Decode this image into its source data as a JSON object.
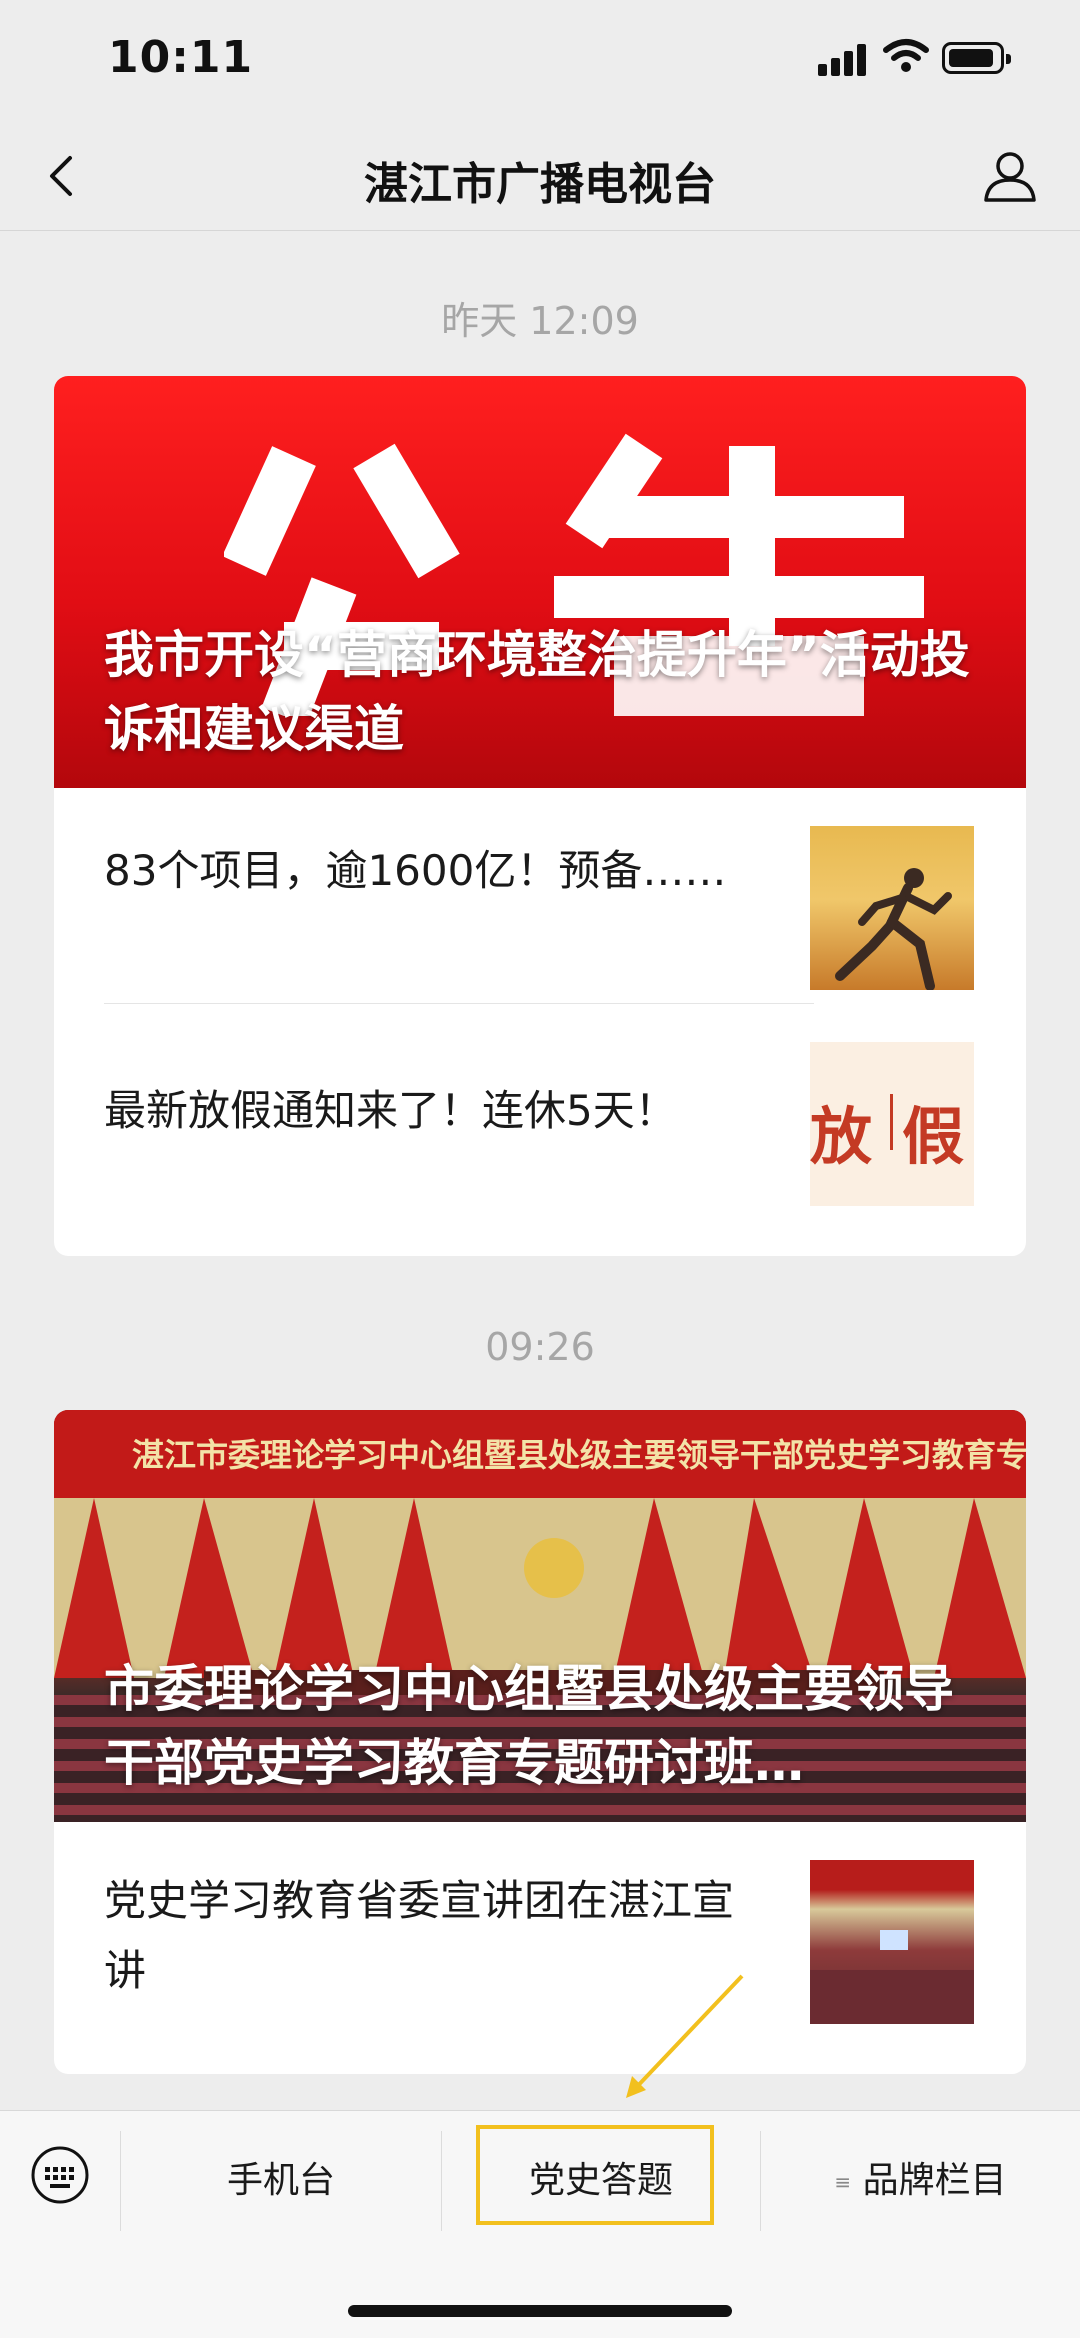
{
  "status_bar": {
    "time": "10:11"
  },
  "nav": {
    "title": "湛江市广播电视台"
  },
  "groups": [
    {
      "timestamp": "昨天 12:09",
      "cover": {
        "title": "我市开设“营商环境整治提升年”活动投诉和建议渠道",
        "image_text": "公告"
      },
      "items": [
        {
          "title": "83个项目，逾1600亿！预备……",
          "thumb": "runner-image"
        },
        {
          "title": "最新放假通知来了！连休5天！",
          "thumb_text_left": "放",
          "thumb_text_right": "假"
        }
      ]
    },
    {
      "timestamp": "09:26",
      "cover": {
        "title": "市委理论学习中心组暨县处级主要领导干部党史学习教育专题研讨班…",
        "banner": "湛江市委理论学习中心组暨县处级主要领导干部党史学习教育专题研讨班"
      },
      "items": [
        {
          "title": "党史学习教育省委宣讲团在湛江宣讲",
          "thumb": "meeting-image"
        }
      ]
    }
  ],
  "bottom_menu": {
    "items": [
      {
        "label": "手机台"
      },
      {
        "label": "党史答题",
        "highlighted": true
      },
      {
        "label": "品牌栏目",
        "has_submenu": true
      }
    ]
  },
  "colors": {
    "highlight": "#f2c01e",
    "cover_red": "#e10d14"
  }
}
